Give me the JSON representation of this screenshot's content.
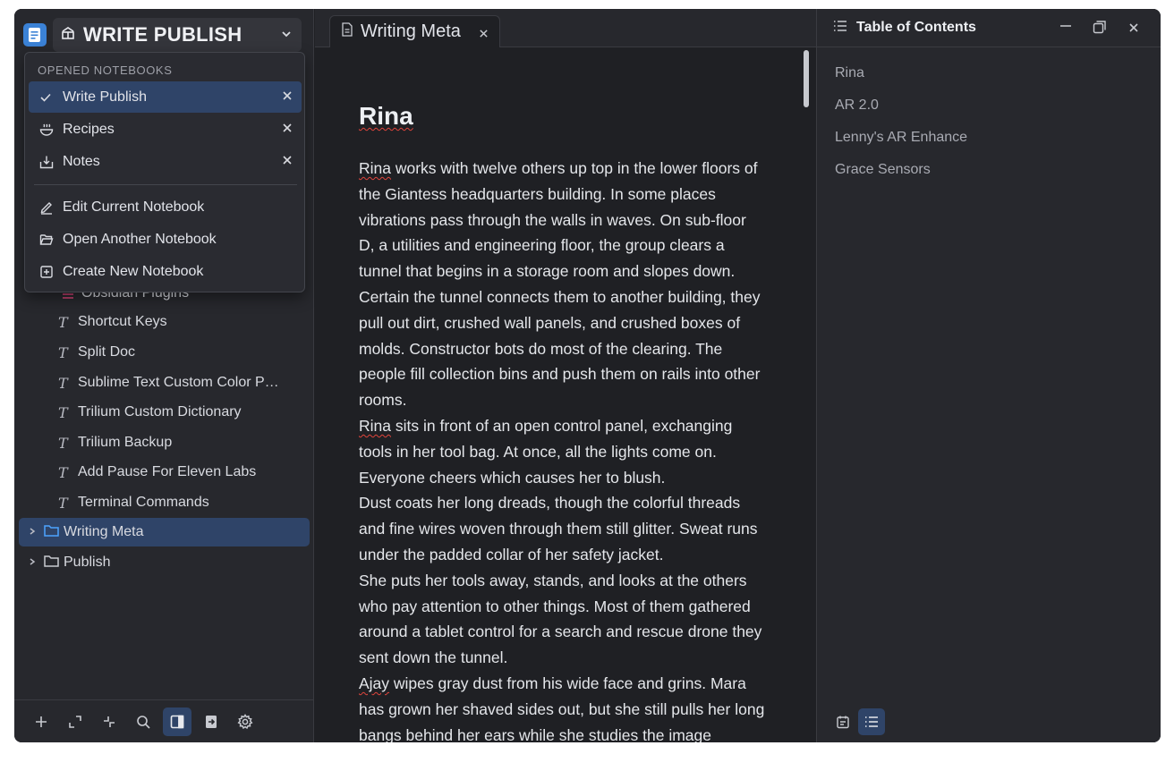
{
  "notebook": {
    "title": "WRITE PUBLISH"
  },
  "dropdown": {
    "section_label": "OPENED NOTEBOOKS",
    "notebooks": [
      {
        "label": "Write Publish",
        "selected": true
      },
      {
        "label": "Recipes",
        "selected": false
      },
      {
        "label": "Notes",
        "selected": false
      }
    ],
    "actions": [
      {
        "label": "Edit Current Notebook"
      },
      {
        "label": "Open Another Notebook"
      },
      {
        "label": "Create New Notebook"
      }
    ]
  },
  "tree": {
    "items": [
      {
        "label": "Obsidian Plugins"
      },
      {
        "label": "Shortcut Keys"
      },
      {
        "label": "Split Doc"
      },
      {
        "label": "Sublime Text Custom Color P…"
      },
      {
        "label": "Trilium Custom Dictionary"
      },
      {
        "label": "Trilium Backup"
      },
      {
        "label": "Add Pause For Eleven Labs"
      },
      {
        "label": "Terminal Commands"
      }
    ],
    "folders": [
      {
        "label": "Writing Meta",
        "selected": true
      },
      {
        "label": "Publish",
        "selected": false
      }
    ]
  },
  "editor": {
    "tab_title": "Writing Meta",
    "heading": "Rina",
    "paragraphs": [
      {
        "first": "Rina",
        "rest": " works with twelve others up top in the lower floors of the Giantess headquarters building. In some places vibrations pass through the walls in waves. On sub-floor D, a utilities and engineering floor, the group clears a tunnel that begins in a storage room and slopes down. Certain the tunnel connects them to another building, they pull out dirt, crushed wall panels, and crushed boxes of molds. Constructor bots do most of the clearing. The people fill collection bins and push them on rails into other rooms."
      },
      {
        "first": "Rina",
        "rest": " sits in front of an open control panel, exchanging tools in her tool bag. At once, all the lights come on. Everyone cheers which causes her to blush."
      },
      {
        "first": "",
        "rest": "Dust coats her long dreads, though the colorful threads and fine wires woven through them still glitter. Sweat runs under the padded collar of her safety jacket."
      },
      {
        "first": "",
        "rest": "She puts her tools away, stands, and looks at the others who pay attention to other things. Most of them gathered around a tablet control for a search and rescue drone they sent down the tunnel."
      },
      {
        "first": "Ajay",
        "rest": " wipes gray dust from his wide face and grins. Mara has grown her shaved sides out, but she still pulls her long bangs behind her ears while she studies the image"
      }
    ]
  },
  "toc": {
    "title": "Table of Contents",
    "items": [
      "Rina",
      "AR 2.0",
      "Lenny's AR Enhance",
      "Grace Sensors"
    ]
  },
  "colors": {
    "accent": "#3b82d6",
    "selection": "#2f4468",
    "folder_accent": "#4da3ff"
  }
}
